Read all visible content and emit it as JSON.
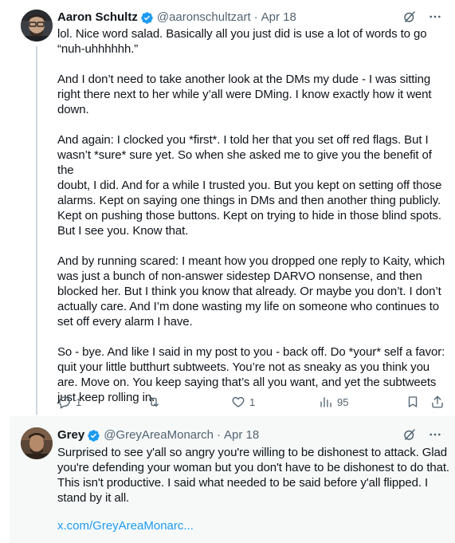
{
  "tweets": [
    {
      "display_name": "Aaron Schultz",
      "handle": "@aaronschultzart",
      "separator": "·",
      "date": "Apr 18",
      "body": "lol. Nice word salad. Basically all you just did is use a lot of words to go\n“nuh-uhhhhhh.”\n\nAnd I don’t need to take another look at the DMs my dude - I was sitting\nright there next to her while y’all were DMing. I know exactly how it went\ndown.\n\nAnd again: I clocked you *first*. I told her that you set off red flags. But I\nwasn’t *sure* sure yet. So when she asked me to give you the benefit of the\ndoubt, I did. And for a while I trusted you. But you kept on setting off those\nalarms. Kept on saying one things in DMs and then another thing publicly.\nKept on pushing those buttons. Kept on trying to hide in those blind spots.\nBut I see you. Know that.\n\nAnd by running scared: I meant how you dropped one reply to Kaity, which\nwas just a bunch of non-answer sidestep DARVO nonsense, and then\nblocked her. But I think you know that already. Or maybe you don’t. I don’t\nactually care. And I’m done wasting my life on someone who continues to\nset off every alarm I have.\n\nSo - bye. And like I said in my post to you - back off. Do *your* self a favor:\nquit your little butthurt subtweets. You’re not as sneaky as you think you\nare. Move on. You keep saying that’s all you want, and yet the subtweets\njust keep rolling in.",
      "stats": {
        "replies": "1",
        "retweets": "",
        "likes": "1",
        "views": "95"
      }
    },
    {
      "display_name": "Grey",
      "handle": "@GreyAreaMonarch",
      "separator": "·",
      "date": "Apr 18",
      "body": "Surprised to see y'all so angry you're willing to be dishonest to attack. Glad\nyou're defending your woman but you don't have to be dishonest to do that.\nThis isn't productive. I said what needed to be said before y'all flipped. I\nstand by it all.",
      "link": "x.com/GreyAreaMonarc..."
    }
  ],
  "icons": {
    "verified": "verified-badge-icon",
    "grok": "grok-icon",
    "more": "more-icon",
    "reply": "reply-icon",
    "retweet": "retweet-icon",
    "like": "like-icon",
    "views": "views-icon",
    "bookmark": "bookmark-icon",
    "share": "share-icon"
  },
  "colors": {
    "text": "#0f1419",
    "secondary": "#536471",
    "accent": "#1d9bf0",
    "thread_line": "#cfd9de",
    "highlight_bg": "#f7f9f9"
  }
}
